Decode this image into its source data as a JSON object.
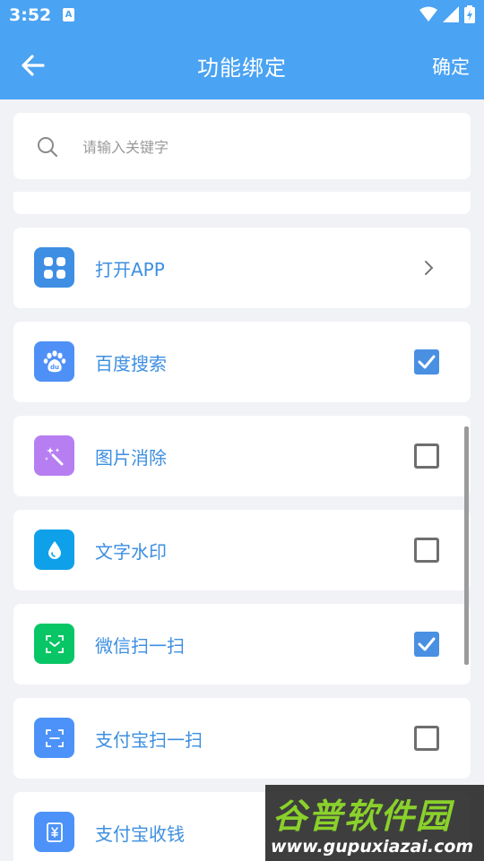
{
  "status_bar": {
    "time": "3:52",
    "notification_icon": "A"
  },
  "app_bar": {
    "title": "功能绑定",
    "confirm_label": "确定",
    "back_icon": "arrow-left-icon"
  },
  "search": {
    "placeholder": "请输入关键字",
    "value": ""
  },
  "colors": {
    "primary": "#4aa3f3",
    "label": "#3d8fe0",
    "checked": "#4a90e2"
  },
  "items": [
    {
      "label": "打开APP",
      "icon": "apps-grid-icon",
      "icon_color": "#3e8ee4",
      "control": "chevron"
    },
    {
      "label": "百度搜索",
      "icon": "baidu-paw-icon",
      "icon_color": "#4f90f6",
      "control": "checkbox",
      "checked": true
    },
    {
      "label": "图片消除",
      "icon": "magic-wand-icon",
      "icon_color": "#b77ef2",
      "control": "checkbox",
      "checked": false
    },
    {
      "label": "文字水印",
      "icon": "water-drop-icon",
      "icon_color": "#0fa0ea",
      "control": "checkbox",
      "checked": false
    },
    {
      "label": "微信扫一扫",
      "icon": "wechat-scan-icon",
      "icon_color": "#08c665",
      "control": "checkbox",
      "checked": true
    },
    {
      "label": "支付宝扫一扫",
      "icon": "alipay-scan-icon",
      "icon_color": "#4d92f8",
      "control": "checkbox",
      "checked": false
    },
    {
      "label": "支付宝收钱",
      "icon": "alipay-receive-icon",
      "icon_color": "#4d92f8",
      "control": "checkbox",
      "checked": false
    }
  ],
  "watermark": {
    "title": "谷普软件园",
    "url": "www.gupuxiazai.com"
  }
}
